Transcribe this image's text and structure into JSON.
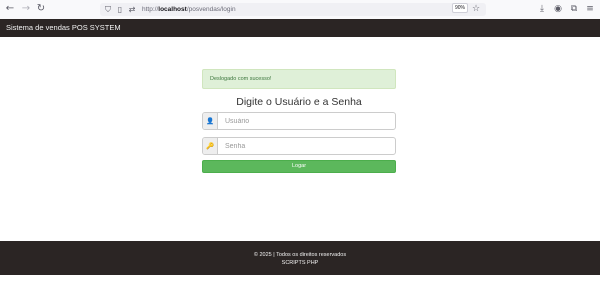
{
  "browser": {
    "url_host": "localhost",
    "url_prefix": "http://",
    "url_path": "/posvendas/login",
    "zoom": "90%"
  },
  "navbar": {
    "brand": "Sistema de vendas POS SYSTEM"
  },
  "login": {
    "alert_message": "Deslogado com sucesso!",
    "title": "Digite o Usuário e a Senha",
    "username_placeholder": "Usuário",
    "password_placeholder": "Senha",
    "submit_label": "Logar"
  },
  "footer": {
    "copyright": "© 2025 | Todos os direitos reservados",
    "credits": "SCRIPTS PHP"
  },
  "colors": {
    "navbar_bg": "#2b2524",
    "alert_bg": "#dff0d8",
    "button_bg": "#5cb85c"
  },
  "icons": [
    "back-icon",
    "forward-icon",
    "reload-icon",
    "shield-icon",
    "page-icon",
    "permissions-icon",
    "star-icon",
    "download-icon",
    "account-icon",
    "extensions-icon",
    "menu-icon",
    "user-icon",
    "key-icon"
  ]
}
